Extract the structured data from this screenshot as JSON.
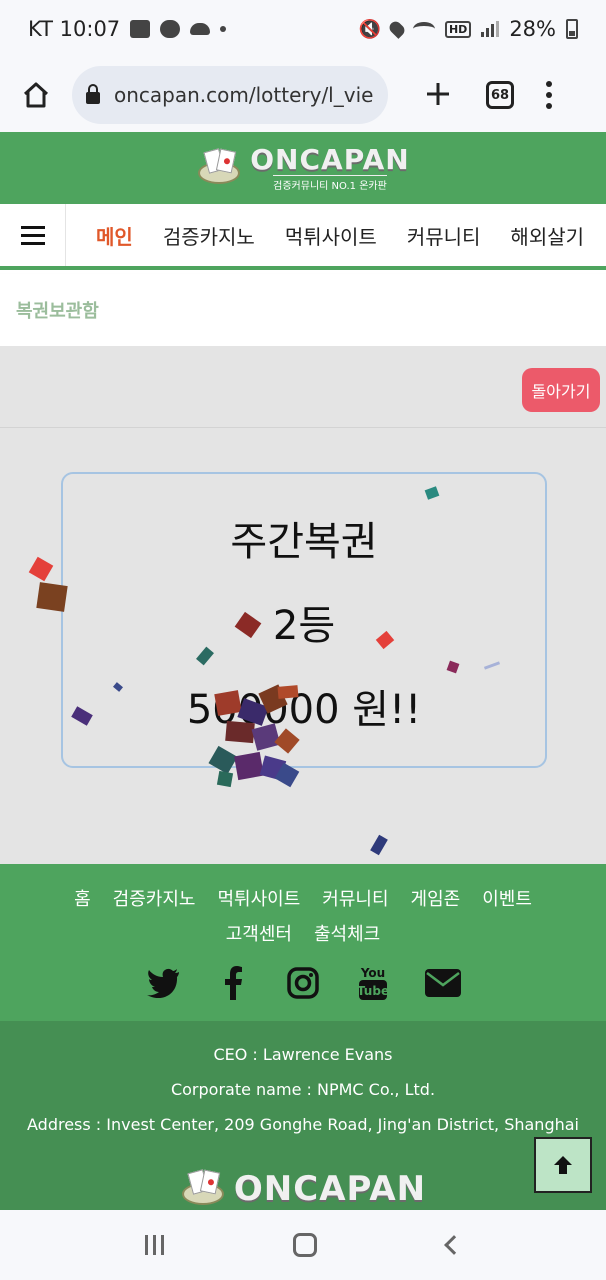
{
  "status_bar": {
    "carrier_time": "KT 10:07",
    "battery": "28%"
  },
  "browser": {
    "url": "oncapan.com/lottery/l_view",
    "tab_count": "68"
  },
  "site": {
    "logo_text": "ONCAPAN",
    "logo_sub": "검증커뮤니티 NO.1 온카판",
    "brand_color": "#4ea45e"
  },
  "nav": {
    "items": [
      {
        "label": "메인",
        "active": true
      },
      {
        "label": "검증카지노"
      },
      {
        "label": "먹튀사이트"
      },
      {
        "label": "커뮤니티"
      },
      {
        "label": "해외살기"
      }
    ]
  },
  "page": {
    "title": "복권보관함",
    "back_label": "돌아가기"
  },
  "prize": {
    "type": "주간복권",
    "rank": "2등",
    "amount": "500000 원!!"
  },
  "footer": {
    "links": [
      "홈",
      "검증카지노",
      "먹튀사이트",
      "커뮤니티",
      "게임존",
      "이벤트",
      "고객센터",
      "출석체크"
    ],
    "social": [
      "twitter-icon",
      "facebook-icon",
      "instagram-icon",
      "youtube-icon",
      "email-icon"
    ],
    "ceo": "CEO : Lawrence Evans",
    "corporate": "Corporate name : NPMC Co., Ltd.",
    "address": "Address : Invest Center, 209 Gonghe Road, Jing'an District, Shanghai",
    "logo_text": "ONCAPAN"
  }
}
